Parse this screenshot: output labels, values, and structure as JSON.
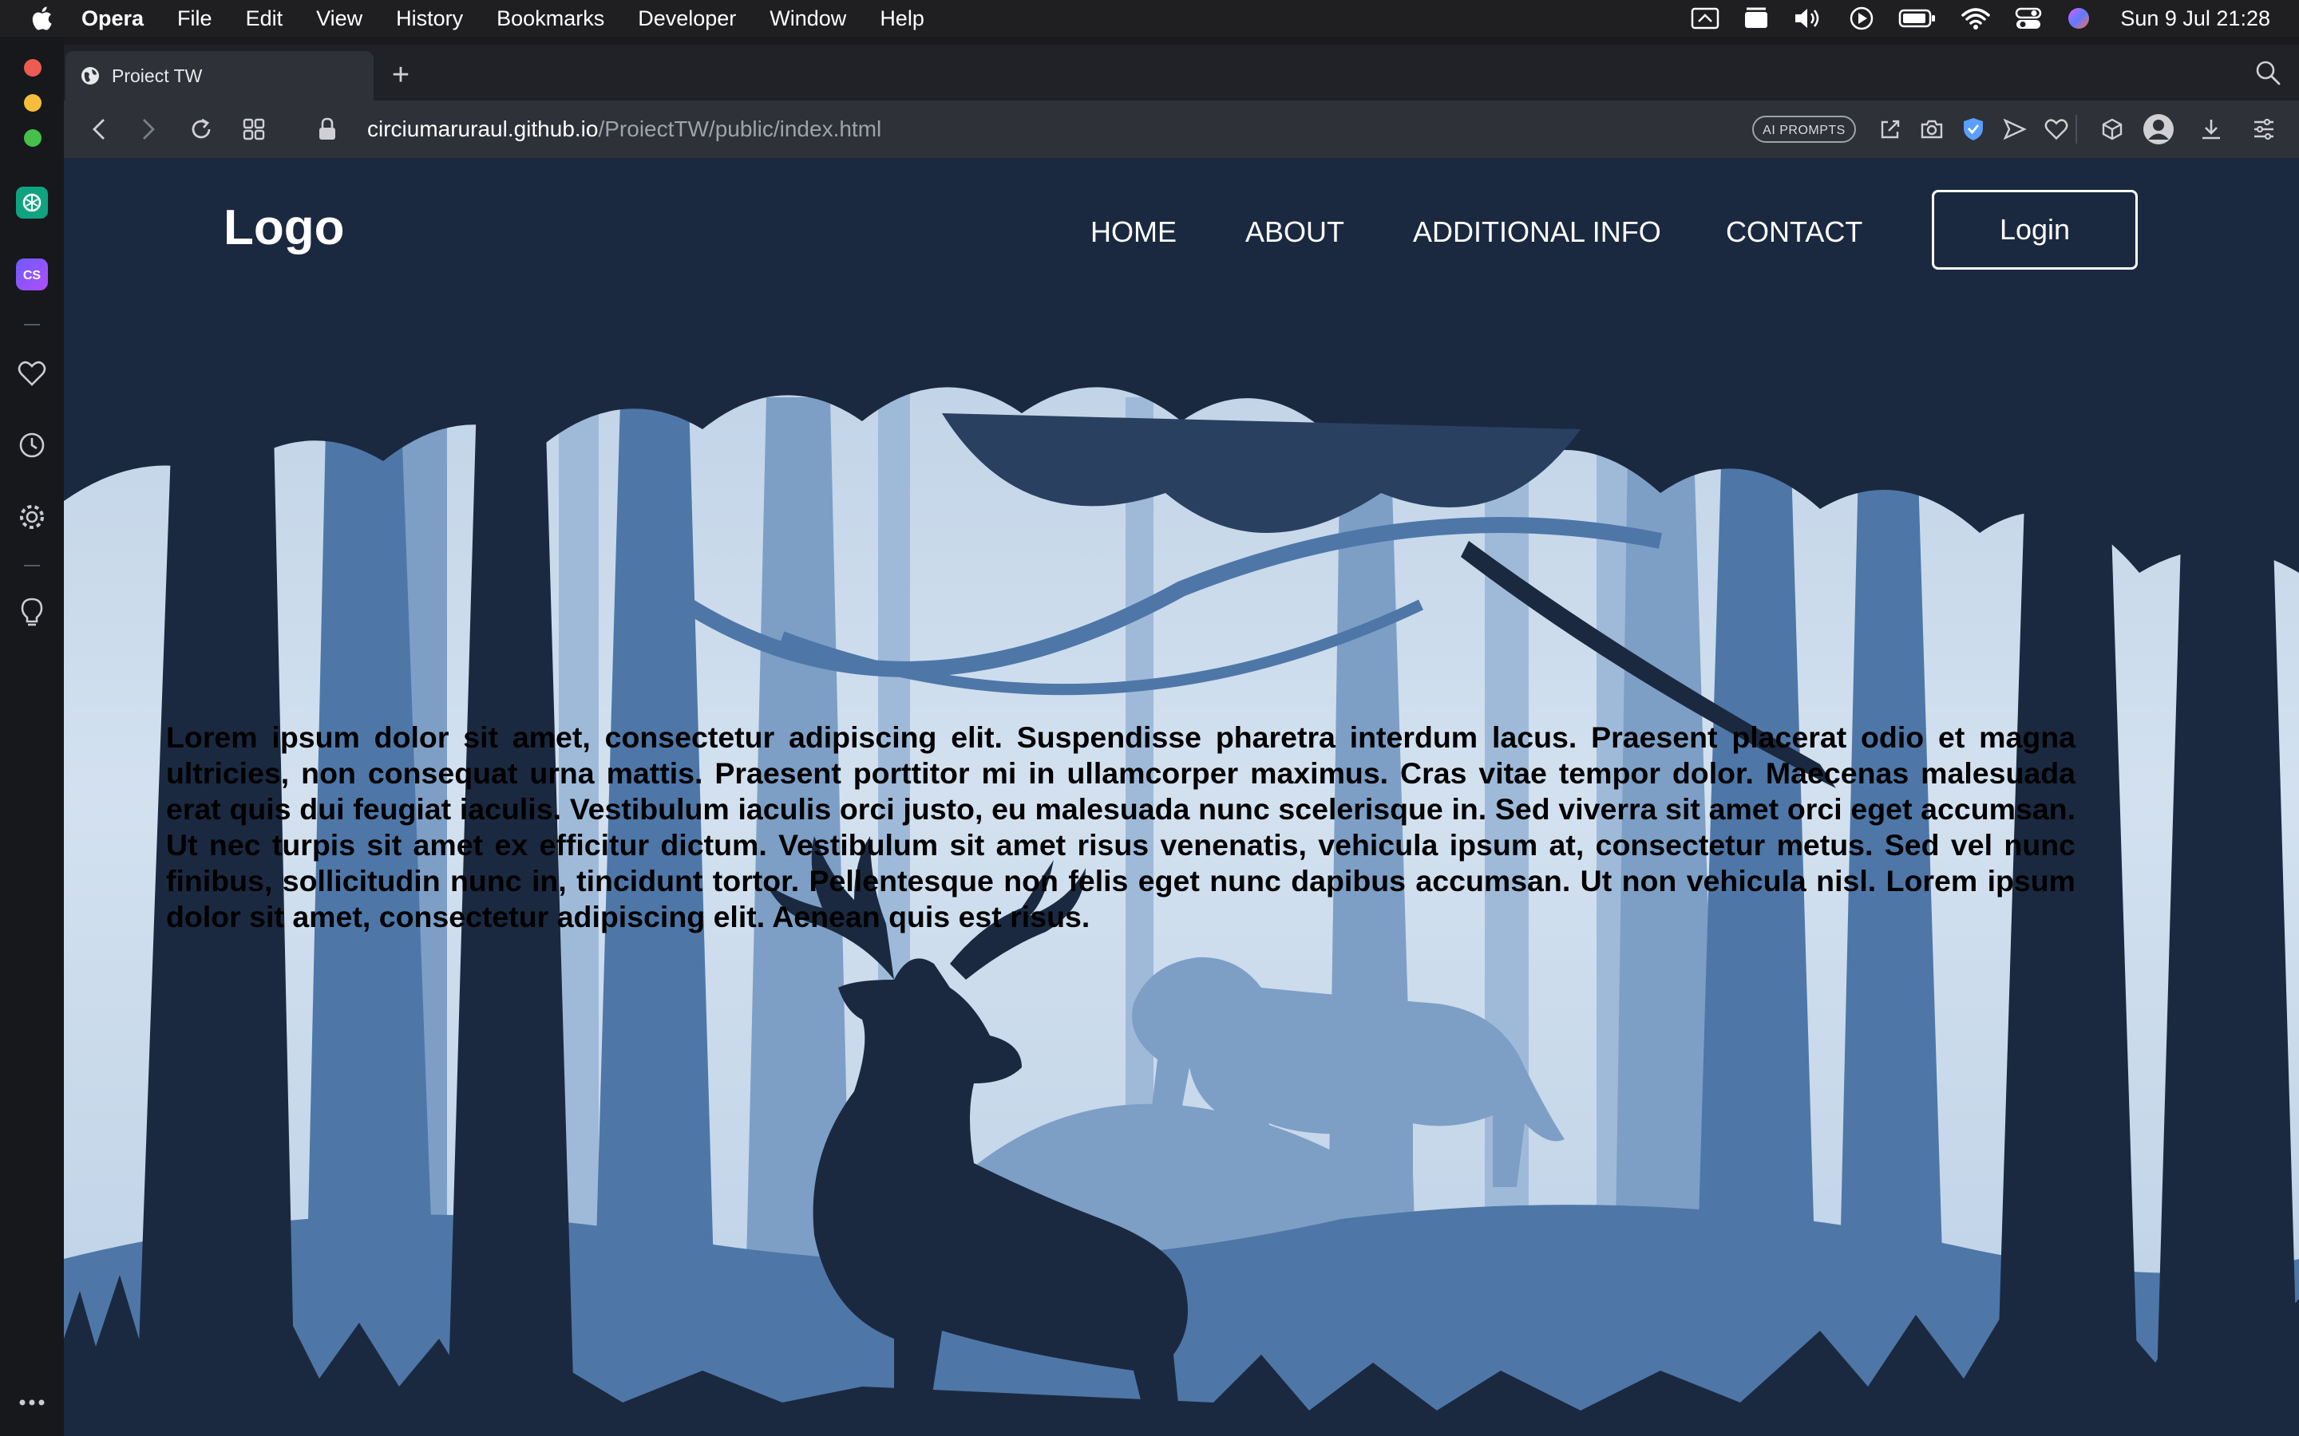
{
  "menubar": {
    "app_name": "Opera",
    "items": [
      "File",
      "Edit",
      "View",
      "History",
      "Bookmarks",
      "Developer",
      "Window",
      "Help"
    ],
    "clock": "Sun 9 Jul  21:28"
  },
  "browser": {
    "tab_title": "Proiect TW",
    "new_tab_label": "+",
    "url_host": "circiumaruraul.github.io",
    "url_path": "/ProiectTW/public/index.html",
    "ai_prompts_label": "AI PROMPTS",
    "sidebar_cs_label": "CS"
  },
  "site": {
    "logo": "Logo",
    "nav": [
      "HOME",
      "ABOUT",
      "ADDITIONAL INFO",
      "CONTACT"
    ],
    "login_label": "Login",
    "body_text": "Lorem ipsum dolor sit amet, consectetur adipiscing elit. Suspendisse pharetra interdum lacus. Praesent placerat odio et magna ultricies, non consequat urna mattis. Praesent porttitor mi in ullamcorper maximus. Cras vitae tempor dolor. Maecenas malesuada erat quis dui feugiat iaculis. Vestibulum iaculis orci justo, eu malesuada nunc scelerisque in. Sed viverra sit amet orci eget accumsan. Ut nec turpis sit amet ex efficitur dictum. Vestibulum sit amet risus venenatis, vehicula ipsum at, consectetur metus. Sed vel nunc finibus, sollicitudin nunc in, tincidunt tortor. Pellentesque non felis eget nunc dapibus accumsan. Ut non vehicula nisl. Lorem ipsum dolor sit amet, consectetur adipiscing elit. Aenean quis est risus."
  },
  "colors": {
    "sky": "#c7d8ea",
    "canopy_dark": "#1b2940",
    "trees_mid": "#4e77a8",
    "trees_light": "#86a8cf",
    "deer": "#1b2940",
    "tiger": "#7d9fc6"
  },
  "icons": {
    "sidebar": [
      "chatgpt-icon",
      "cs-extension-icon",
      "heart-icon",
      "history-icon",
      "settings-icon",
      "lightbulb-icon",
      "more-icon"
    ],
    "toolbar": [
      "back-icon",
      "forward-icon",
      "reload-icon",
      "tab-grid-icon",
      "lock-icon",
      "share-icon",
      "camera-icon",
      "shield-icon",
      "send-icon",
      "heart-icon",
      "box-icon",
      "profile-icon",
      "download-icon",
      "easy-setup-icon"
    ]
  }
}
